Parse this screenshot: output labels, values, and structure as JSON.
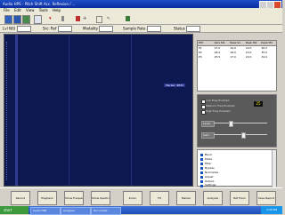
{
  "window": {
    "title": "Audio HPS - Pitch Shift Acc. Reflexion / ..."
  },
  "menu": [
    "File",
    "Edit",
    "View",
    "Tools",
    "Help"
  ],
  "optionbar": {
    "items": [
      "Lvl N/U",
      "Src: Ref",
      "Modality",
      "Sample Rate",
      "Status"
    ]
  },
  "plot": {
    "marker_label": "Marker: 9832"
  },
  "table": {
    "headers": [
      "HM",
      "Vers M1",
      "Peak S1",
      "Peak M2",
      "Peak M3"
    ],
    "rows": [
      [
        "P1",
        "27.0",
        "19.0",
        "24.0",
        "36.0"
      ],
      [
        "P2",
        "26.0",
        "18.0",
        "23.0",
        "35.0"
      ],
      [
        "P3",
        "25.5",
        "17.0",
        "22.0",
        "34.0"
      ]
    ]
  },
  "controls": {
    "checks": [
      "Low Freq Enabled",
      "Medium Freq Enabled",
      "High Freq Enabled"
    ],
    "value": "25",
    "sliders": [
      {
        "label": "Level",
        "level": 0.3
      },
      {
        "label": "Gain",
        "level": 0.55
      }
    ]
  },
  "tree": {
    "items": [
      "Band",
      "Mode",
      "Filter",
      "Bypass",
      "Normalize",
      "Adjust",
      "Output",
      "Settings"
    ]
  },
  "func_buttons": [
    "Record",
    "Playback",
    "Show Frequency",
    "Show Spectrum",
    "Zoom",
    "Fit",
    "Marker",
    "Analyzer",
    "Ref Track",
    "Save Report"
  ],
  "taskbar": {
    "start": "start",
    "tasks": [
      "Audio HPS",
      "Analyzer",
      "Document"
    ],
    "clock": "3:30 PM"
  }
}
